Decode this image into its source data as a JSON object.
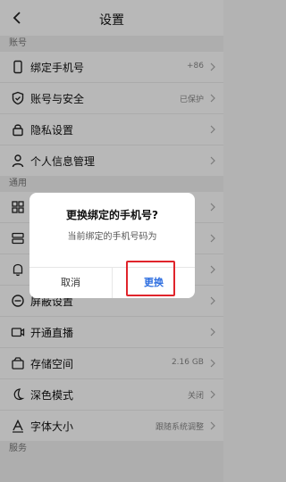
{
  "header": {
    "title": "设置"
  },
  "sections": [
    {
      "label": "账号",
      "items": [
        {
          "icon": "phone-icon",
          "label": "绑定手机号",
          "value": "+86"
        },
        {
          "icon": "shield-icon",
          "label": "账号与安全",
          "value": "已保护"
        },
        {
          "icon": "lock-icon",
          "label": "隐私设置",
          "value": ""
        },
        {
          "icon": "user-icon",
          "label": "个人信息管理",
          "value": ""
        }
      ]
    },
    {
      "label": "通用",
      "items": [
        {
          "icon": "grid-icon",
          "label": "",
          "value": ""
        },
        {
          "icon": "layers-icon",
          "label": "",
          "value": ""
        },
        {
          "icon": "bell-icon",
          "label": "",
          "value": ""
        },
        {
          "icon": "block-icon",
          "label": "屏蔽设置",
          "value": ""
        },
        {
          "icon": "live-icon",
          "label": "开通直播",
          "value": ""
        },
        {
          "icon": "storage-icon",
          "label": "存储空间",
          "value": "2.16 GB"
        },
        {
          "icon": "moon-icon",
          "label": "深色模式",
          "value": "关闭"
        },
        {
          "icon": "font-icon",
          "label": "字体大小",
          "value": "跟随系统调整"
        }
      ]
    },
    {
      "label": "服务",
      "items": []
    }
  ],
  "dialog": {
    "title": "更换绑定的手机号?",
    "message": "当前绑定的手机号码为",
    "phone_masked": "",
    "cancel": "取消",
    "confirm": "更换"
  }
}
